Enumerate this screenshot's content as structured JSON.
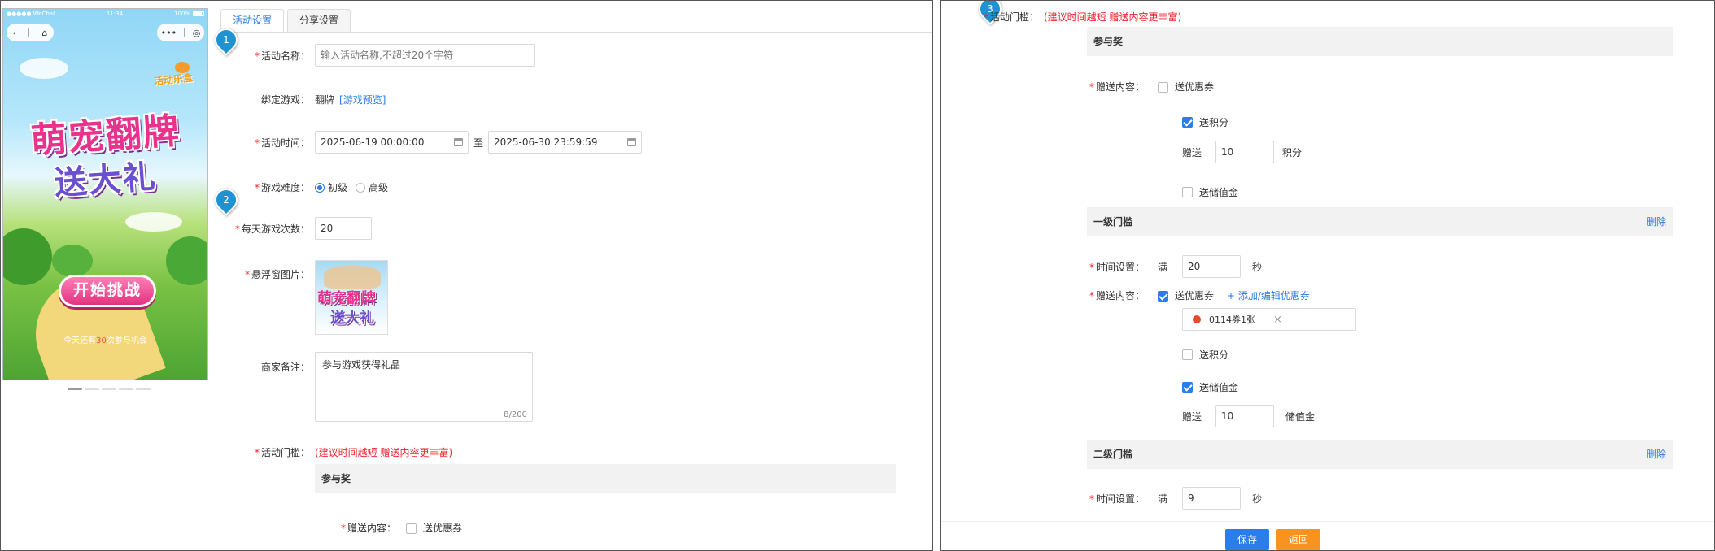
{
  "preview": {
    "status_left": "●●●●● WeChat",
    "status_time": "11:34",
    "status_battery": "100%",
    "nav_back": "‹",
    "nav_home": "⌂",
    "nav_more": "•••",
    "nav_close": "◎",
    "brand_text": "活动乐盒",
    "hero_line1": "萌宠翻牌",
    "hero_line2": "送大礼",
    "start_button": "开始挑战",
    "chance_prefix": "今天还有",
    "chance_num": "30",
    "chance_suffix": "次参与机会"
  },
  "tabs": [
    {
      "label": "活动设置"
    },
    {
      "label": "分享设置"
    }
  ],
  "markers": [
    "1",
    "2",
    "3"
  ],
  "form": {
    "name_label": "活动名称：",
    "name_placeholder": "输入活动名称,不超过20个字符",
    "game_label": "绑定游戏：",
    "game_value": "翻牌",
    "game_preview_link": "[游戏预览]",
    "time_label": "活动时间：",
    "time_start": "2025-06-19 00:00:00",
    "time_to": "至",
    "time_end": "2025-06-30 23:59:59",
    "difficulty_label": "游戏难度：",
    "difficulty_easy": "初级",
    "difficulty_hard": "高级",
    "daily_label": "每天游戏次数：",
    "daily_value": "20",
    "float_image_label": "悬浮窗图片：",
    "thumb_line1": "萌宠翻牌",
    "thumb_line2": "送大礼",
    "remark_label": "商家备注：",
    "remark_value": "参与游戏获得礼品",
    "remark_count": "8/200",
    "threshold_label": "活动门槛：",
    "threshold_hint": "(建议时间越短 赠送内容更丰富)",
    "participation_title": "参与奖",
    "gift_content_label": "赠送内容：",
    "send_coupon": "送优惠券"
  },
  "right": {
    "threshold_label": "活动门槛：",
    "threshold_hint": "(建议时间越短 赠送内容更丰富)",
    "participation_title": "参与奖",
    "gift_content_label": "赠送内容：",
    "send_coupon": "送优惠券",
    "send_points": "送积分",
    "give_label": "赠送",
    "points_value": "10",
    "points_unit": "积分",
    "send_stored_value": "送储值金",
    "level1_title": "一级门槛",
    "delete_label": "删除",
    "time_setting_label": "时间设置：",
    "full_label": "满",
    "level1_seconds": "20",
    "seconds_unit": "秒",
    "add_coupon_link": "+ 添加/编辑优惠券",
    "coupon_name": "0114券1张",
    "coupon_remove": "×",
    "stored_value_amount": "10",
    "stored_value_unit": "储值金",
    "level2_title": "二级门槛",
    "level2_seconds": "9",
    "save_button": "保存",
    "back_button": "返回"
  },
  "colors": {
    "primary": "#2b7de9",
    "required": "#f5222d",
    "marker": "#1f93d2",
    "back_button": "#f7931e"
  }
}
